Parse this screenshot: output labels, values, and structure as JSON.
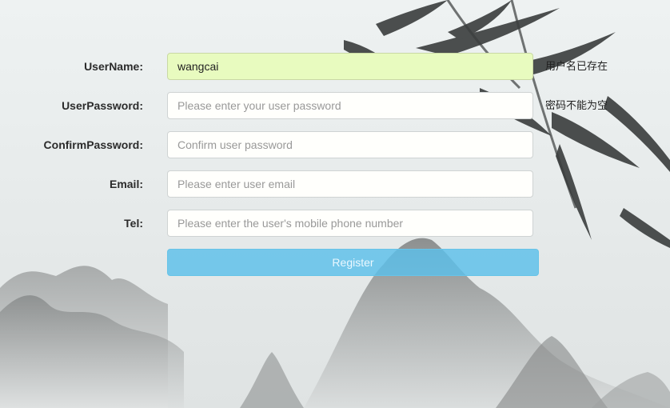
{
  "form": {
    "username": {
      "label": "UserName:",
      "value": "wangcai",
      "placeholder": "",
      "hint": "用户名已存在"
    },
    "password": {
      "label": "UserPassword:",
      "placeholder": "Please enter your user password",
      "hint": "密码不能为空"
    },
    "confirm": {
      "label": "ConfirmPassword:",
      "placeholder": "Confirm user password"
    },
    "email": {
      "label": "Email:",
      "placeholder": "Please enter user email"
    },
    "tel": {
      "label": "Tel:",
      "placeholder": "Please enter the user's mobile phone number"
    },
    "submit_label": "Register"
  },
  "colors": {
    "autofill_bg": "#e8fbbf",
    "button": "#5bc0ea",
    "background": "#e9eded"
  },
  "background_art": "ink-wash-mountains-and-bamboo"
}
